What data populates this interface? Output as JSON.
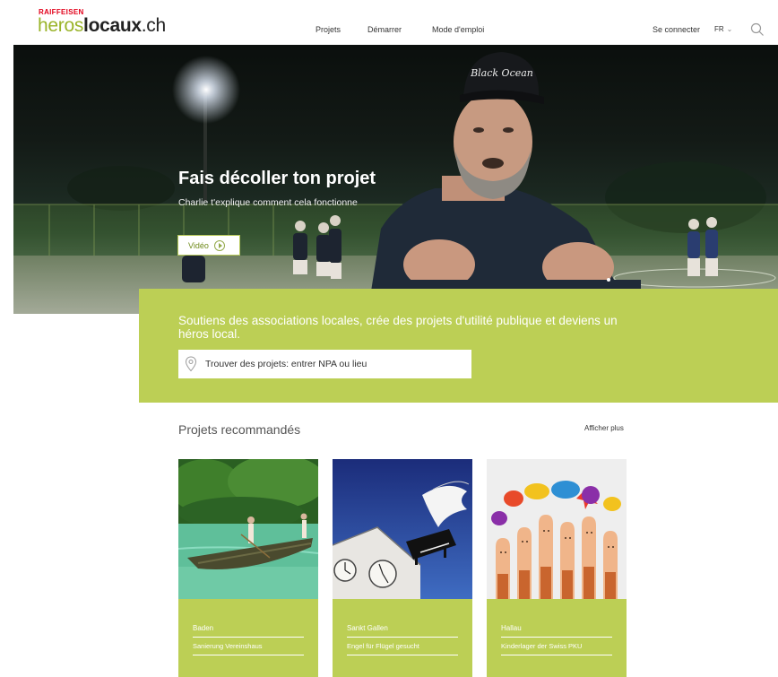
{
  "header": {
    "brand_top": "RAIFFEISEN",
    "brand_heros": "heros",
    "brand_locaux": "locaux",
    "brand_tld": ".ch",
    "nav": [
      "Projets",
      "Démarrer",
      "Mode d'emploi"
    ],
    "login": "Se connecter",
    "lang": "FR",
    "search_icon": "search-icon"
  },
  "hero": {
    "title": "Fais décoller ton projet",
    "subtitle": "Charlie t'explique comment cela fonctionne",
    "video_label": "Vidéo",
    "cap_text": "Black Ocean"
  },
  "banner": {
    "text": "Soutiens des associations locales, crée des projets d'utilité publique et deviens un héros local.",
    "search_placeholder": "Trouver des projets: entrer NPA ou lieu",
    "search_icon": "location-pin-icon"
  },
  "recommended": {
    "title": "Projets recommandés",
    "more": "Afficher plus",
    "cards": [
      {
        "location": "Baden",
        "project": "Sanierung Vereinshaus"
      },
      {
        "location": "Sankt Gallen",
        "project": "Engel für Flügel gesucht"
      },
      {
        "location": "Hallau",
        "project": "Kinderlager der Swiss PKU"
      }
    ]
  },
  "colors": {
    "accent_green": "#bccf55",
    "brand_green": "#9ab42a",
    "brand_red": "#e2001a"
  }
}
